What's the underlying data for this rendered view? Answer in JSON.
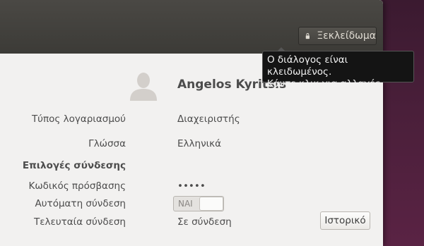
{
  "header": {
    "unlock_button": {
      "label": "Ξεκλείδωμα",
      "icon": "lock-icon"
    }
  },
  "tooltip": {
    "line1": "Ο διάλογος είναι κλειδωμένος.",
    "line2": "Κάντε κλικ για αλλαγές"
  },
  "user": {
    "avatar_icon": "user-avatar-icon",
    "name": "Angelos Kyritsis"
  },
  "fields": {
    "account_type": {
      "label": "Τύπος λογαριασμού",
      "value": "Διαχειριστής"
    },
    "language": {
      "label": "Γλώσσα",
      "value": "Ελληνικά"
    }
  },
  "login_options": {
    "heading": "Επιλογές σύνδεσης",
    "password": {
      "label": "Κωδικός πρόσβασης",
      "value": "•••••"
    },
    "auto_login": {
      "label": "Αυτόματη σύνδεση",
      "toggle_text": "ΝΑΙ",
      "enabled": true
    },
    "last_login": {
      "label": "Τελευταία σύνδεση",
      "value": "Σε σύνδεση",
      "history_button": "Ιστορικό"
    }
  },
  "colors": {
    "header": "#3c3b37",
    "content_bg": "#f2f1f0",
    "desktop": "#4a1f3a",
    "tooltip_bg": "#141414"
  }
}
